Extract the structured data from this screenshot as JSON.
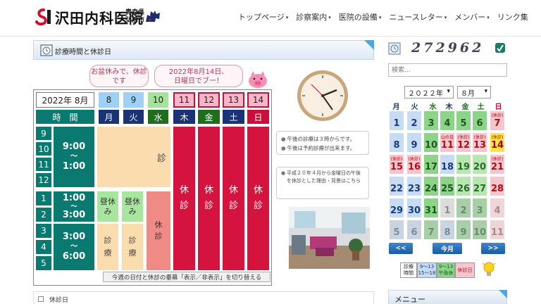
{
  "header": {
    "logo_text": "沢田内科医院",
    "location_line1": "青森県",
    "location_line2": "弘前市",
    "nav": [
      {
        "label": "トップページ",
        "caret": "▾"
      },
      {
        "label": "診察案内",
        "caret": "▾"
      },
      {
        "label": "医院の設備",
        "caret": "▾"
      },
      {
        "label": "ニュースレター",
        "caret": "▾"
      },
      {
        "label": "メンバー",
        "caret": "▾"
      },
      {
        "label": "リンク集",
        "caret": ""
      }
    ]
  },
  "section": {
    "title": "診療時間と休診日"
  },
  "bubbles": {
    "left_line1": "お盆休みで、休診です",
    "right_line1": "2022年8月14日、",
    "right_line2": "日曜日でブー！"
  },
  "schedule": {
    "year_month": "2022年 8月",
    "dates": [
      "8",
      "9",
      "10",
      "11",
      "12",
      "13",
      "14"
    ],
    "time_header": "時　間",
    "weekdays": [
      "月",
      "火",
      "水",
      "木",
      "金",
      "土",
      "日"
    ],
    "hours": [
      "9",
      "10",
      "11",
      "12",
      "1",
      "2",
      "3",
      "4",
      "5"
    ],
    "morning_time": "9:00〜1:00",
    "morning_from": "9:00",
    "morning_tilde": "〜",
    "morning_to": "1:00",
    "noon_from": "1:00",
    "noon_tilde": "〜",
    "noon_to": "3:00",
    "evening_from": "3:00",
    "evening_tilde": "〜",
    "evening_to": "6:00",
    "morning_status": "診",
    "closed_label": "休診",
    "closed_char1": "休",
    "closed_char2": "診",
    "lunch_label1": "昼休",
    "lunch_label2": "み",
    "shinryo1": "診",
    "shinryo2": "療",
    "wed_closed1": "休",
    "wed_closed2": "診",
    "toggle_note": "今週の日付と休診の垂幕「表示／非表示」を切り替える"
  },
  "notes": [
    "午後の診療は３時からです。",
    "午後は予約診療が出来ます。"
  ],
  "info": "平成２０年４月から金曜日の午後を休診とした理由・背景はこちら",
  "bottom": {
    "title": "休診日"
  },
  "sidebar": {
    "counter": "272962",
    "search_placeholder": "検索...",
    "year_select": "２０２２年",
    "month_select": "８月",
    "cal_headers": [
      "月",
      "火",
      "水",
      "木",
      "金",
      "土",
      "日"
    ],
    "weeks": [
      [
        "1",
        "2",
        "3",
        "4",
        "5",
        "6",
        "7"
      ],
      [
        "8",
        "9",
        "10",
        "11",
        "12",
        "13",
        "14"
      ],
      [
        "15",
        "16",
        "17",
        "18",
        "19",
        "20",
        "21"
      ],
      [
        "22",
        "23",
        "24",
        "25",
        "26",
        "27",
        "28"
      ],
      [
        "29",
        "30",
        "31",
        "1",
        "2",
        "3",
        "4"
      ],
      [
        "5",
        "6",
        "7",
        "8",
        "9",
        "10",
        "11"
      ]
    ],
    "holiday_labels": [
      "山の日",
      "(休診)",
      "(休診)",
      "(休診)",
      "(休診)",
      "(休診)",
      "(休診)",
      "(休診)"
    ],
    "prev_btn": "<<",
    "today_btn": "今月",
    "next_btn": ">>",
    "legend": [
      {
        "l1": "診療",
        "l2": "時間"
      },
      {
        "l1": "9〜13",
        "l2": "15〜18"
      },
      {
        "l1": "9〜13",
        "l2": "午後休"
      },
      {
        "l1": "休診日",
        "l2": ""
      }
    ],
    "menu_title": "メニュー"
  },
  "colors": {
    "teal": "#0a7a70",
    "closed_red": "#d4143e",
    "accent_blue": "#4aa8e0",
    "calendar_green": "#8ed38a",
    "calendar_pink": "#f5c6d0",
    "today_yellow": "#ffe34a"
  }
}
